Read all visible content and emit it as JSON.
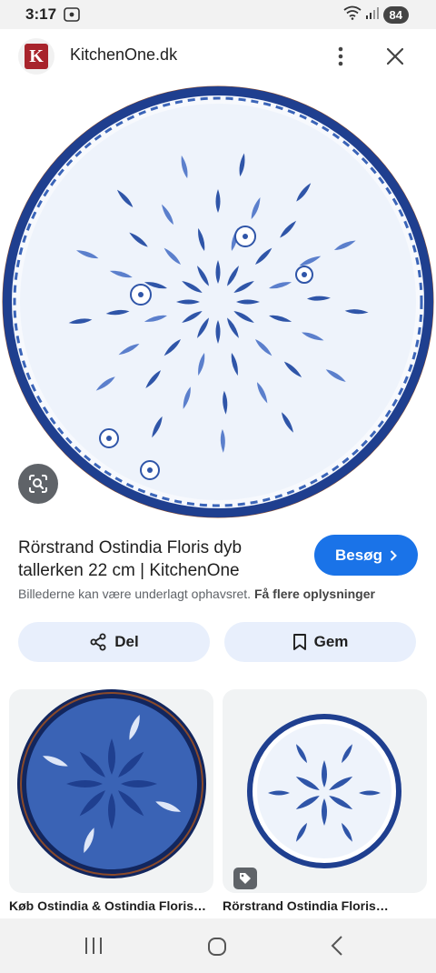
{
  "status_bar": {
    "time": "3:17",
    "battery": "84"
  },
  "header": {
    "logo_letter": "K",
    "site_name": "KitchenOne.dk"
  },
  "result": {
    "title": "Rörstrand Ostindia Floris dyb tallerken 22 cm | KitchenOne",
    "visit_label": "Besøg",
    "copyright_text": "Billederne kan være underlagt ophavsret.",
    "more_info_link": "Få flere oplysninger"
  },
  "actions": {
    "share_label": "Del",
    "save_label": "Gem"
  },
  "related": [
    {
      "caption": "Køb Ostindia & Ostindia Floris…"
    },
    {
      "caption": "Rörstrand Ostindia Floris…"
    }
  ],
  "colors": {
    "accent": "#1a73e8",
    "pill_bg": "#e8effc",
    "porcelain_blue": "#2f55a8"
  },
  "icons": [
    "screenshot-icon",
    "wifi-icon",
    "signal-icon",
    "more-vert-icon",
    "close-icon",
    "lens-icon",
    "chevron-right-icon",
    "share-icon",
    "bookmark-icon",
    "tag-icon",
    "recent-apps-icon",
    "home-icon",
    "back-icon"
  ]
}
